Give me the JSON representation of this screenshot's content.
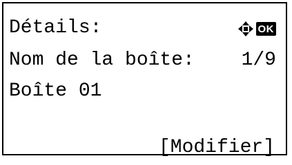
{
  "screen": {
    "title": "Détails:",
    "field_label": "Nom de la boîte:",
    "page_indicator": "1/9",
    "field_value": "Boîte 01",
    "softkey_right": "[Modifier]",
    "icons": {
      "navigation": "four-way-arrows-icon",
      "ok": "OK"
    }
  }
}
